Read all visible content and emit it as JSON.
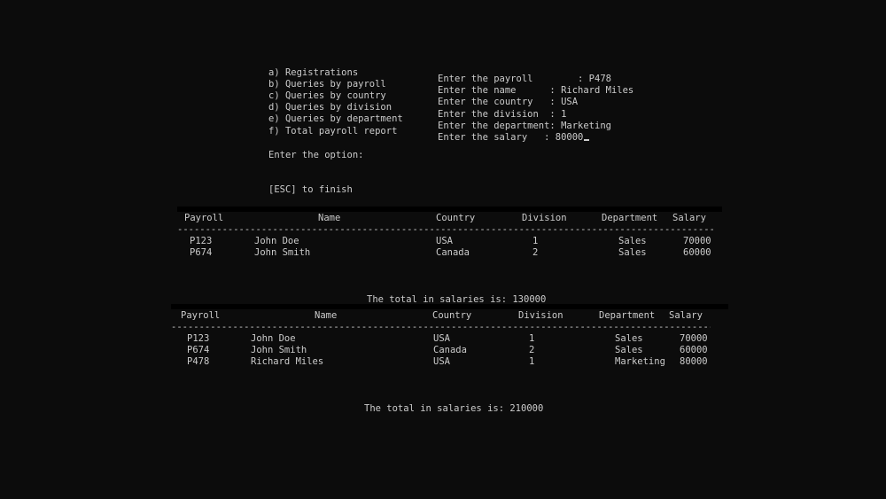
{
  "menu": {
    "items": [
      "a) Registrations",
      "b) Queries by payroll",
      "c) Queries by country",
      "d) Queries by division",
      "e) Queries by department",
      "f) Total payroll report"
    ],
    "prompt": "Enter the option:",
    "exit_hint": "[ESC] to finish"
  },
  "form": {
    "lines": [
      "Enter the payroll        : P478",
      "Enter the name      : Richard Miles",
      "Enter the country   : USA",
      "Enter the division  : 1",
      "Enter the department: Marketing",
      "Enter the salary   : 80000"
    ]
  },
  "table_headers": [
    "Payroll",
    "Name",
    "Country",
    "Division",
    "Department",
    "Salary"
  ],
  "table1": {
    "rows": [
      [
        "P123",
        "John Doe",
        "USA",
        "1",
        "Sales",
        "70000"
      ],
      [
        "P674",
        "John Smith",
        "Canada",
        "2",
        "Sales",
        "60000"
      ]
    ],
    "total": "The total in salaries is: 130000"
  },
  "table2": {
    "rows": [
      [
        "P123",
        "John Doe",
        "USA",
        "1",
        "Sales",
        "70000"
      ],
      [
        "P674",
        "John Smith",
        "Canada",
        "2",
        "Sales",
        "60000"
      ],
      [
        "P478",
        "Richard Miles",
        "USA",
        "1",
        "Marketing",
        "80000"
      ]
    ],
    "total": "The total in salaries is: 210000"
  },
  "colors": {
    "background": "#0c0c0c",
    "text": "#cccccc"
  }
}
